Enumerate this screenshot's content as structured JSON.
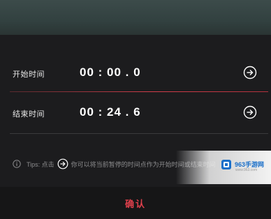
{
  "start": {
    "label": "开始时间",
    "time": "00 : 00 . 0",
    "button_icon": "arrow-right-circle-icon"
  },
  "end": {
    "label": "结束时间",
    "time": "00 : 24 . 6",
    "button_icon": "arrow-right-circle-icon"
  },
  "tips": {
    "prefix": "Tips: 点击",
    "suffix": "你可以将当前暂停的时间点作为开始时间或结束时间",
    "info_icon": "info-circle-icon",
    "arrow_icon": "arrow-right-circle-icon"
  },
  "confirm_label": "确认",
  "watermark": {
    "text": "963手游网",
    "sub": "www.963.com"
  },
  "colors": {
    "accent": "#e0404c",
    "background": "#1c1c1e",
    "divider_active": "#d23d4a"
  }
}
